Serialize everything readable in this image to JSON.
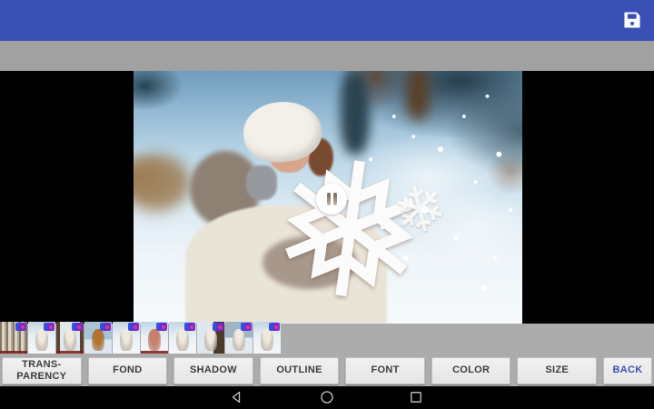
{
  "appbar": {
    "background_color": "#3a50b5",
    "save_icon": "save-icon"
  },
  "subtoolbar": {
    "background_color": "#a1a1a1"
  },
  "viewer": {
    "background_color": "#000000",
    "overlay_button_icon": "pause-icon"
  },
  "thumbnail_strip": {
    "count": 10,
    "badge_icon": "premium-badge",
    "items": [
      {
        "index": 1
      },
      {
        "index": 2
      },
      {
        "index": 3
      },
      {
        "index": 4
      },
      {
        "index": 5
      },
      {
        "index": 6
      },
      {
        "index": 7
      },
      {
        "index": 8
      },
      {
        "index": 9
      },
      {
        "index": 10
      }
    ]
  },
  "action_bar": {
    "background_color": "#acacac",
    "buttons": [
      {
        "label": "TRANS-PARENCY"
      },
      {
        "label": "FOND"
      },
      {
        "label": "SHADOW"
      },
      {
        "label": "OUTLINE"
      },
      {
        "label": "FONT"
      },
      {
        "label": "COLOR"
      },
      {
        "label": "SIZE"
      },
      {
        "label": "BACK",
        "accent_color": "#3b52b0"
      }
    ]
  },
  "navbar": {
    "background_color": "#000000",
    "icons": [
      "back",
      "home",
      "recents"
    ]
  }
}
